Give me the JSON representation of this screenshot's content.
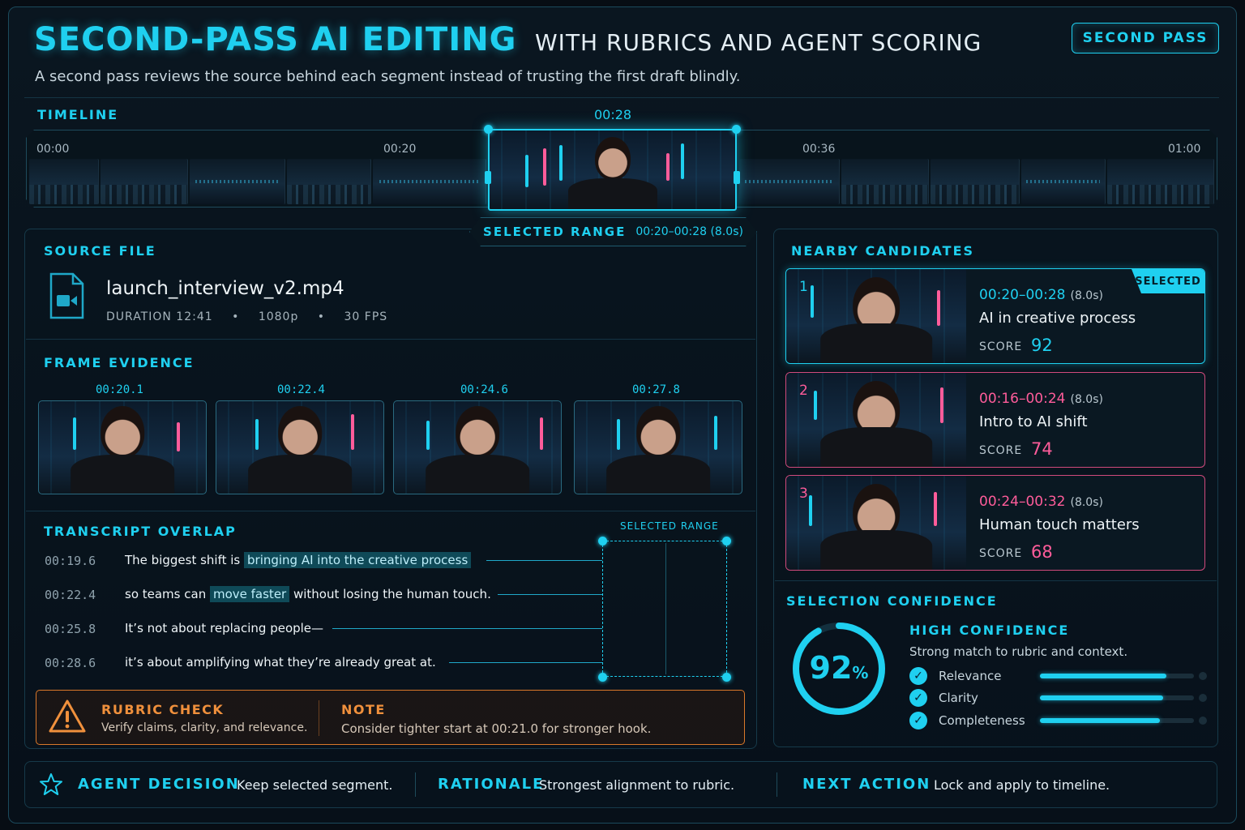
{
  "header": {
    "title": "SECOND-PASS AI EDITING",
    "title_sub": "WITH RUBRICS AND AGENT SCORING",
    "badge": "SECOND PASS",
    "subtitle": "A second pass reviews the source behind each segment instead of trusting the first draft blindly."
  },
  "timeline": {
    "label": "TIMELINE",
    "current": "00:28",
    "ticks": [
      "00:00",
      "00:20",
      "00:36",
      "01:00"
    ]
  },
  "selected_range": {
    "label": "SELECTED RANGE",
    "value": "00:20–00:28 (8.0s)"
  },
  "source_file": {
    "label": "SOURCE FILE",
    "name": "launch_interview_v2.mp4",
    "duration": "DURATION 12:41",
    "resolution": "1080p",
    "fps": "30 FPS",
    "bullet": "•"
  },
  "frame_evidence": {
    "label": "FRAME EVIDENCE",
    "times": [
      "00:20.1",
      "00:22.4",
      "00:24.6",
      "00:27.8"
    ]
  },
  "transcript": {
    "label": "TRANSCRIPT OVERLAP",
    "selected_label": "SELECTED RANGE",
    "lines": [
      {
        "time": "00:19.6",
        "pre": "The biggest shift is ",
        "hl": "bringing AI into the creative process",
        "post": ""
      },
      {
        "time": "00:22.4",
        "pre": "so teams can ",
        "hl": "move faster",
        "post": " without losing the human touch."
      },
      {
        "time": "00:25.8",
        "pre": "It’s not about replacing people—",
        "hl": "",
        "post": ""
      },
      {
        "time": "00:28.6",
        "pre": "it’s about amplifying what they’re already great at.",
        "hl": "",
        "post": ""
      }
    ]
  },
  "rubric": {
    "label": "RUBRIC CHECK",
    "text": "Verify claims, clarity, and relevance.",
    "note_label": "NOTE",
    "note": "Consider tighter start at 00:21.0 for stronger hook."
  },
  "candidates": {
    "label": "NEARBY CANDIDATES",
    "selected_tag": "SELECTED",
    "score_label": "SCORE",
    "items": [
      {
        "num": "1",
        "range": "00:20–00:28",
        "dur": "(8.0s)",
        "caption": "AI in creative process",
        "score": "92"
      },
      {
        "num": "2",
        "range": "00:16–00:24",
        "dur": "(8.0s)",
        "caption": "Intro to AI shift",
        "score": "74"
      },
      {
        "num": "3",
        "range": "00:24–00:32",
        "dur": "(8.0s)",
        "caption": "Human touch matters",
        "score": "68"
      }
    ]
  },
  "confidence": {
    "label": "SELECTION CONFIDENCE",
    "value": "92",
    "unit": "%",
    "fraction": 0.92,
    "level": "HIGH CONFIDENCE",
    "desc": "Strong match to rubric and context.",
    "metrics": [
      {
        "name": "Relevance",
        "fraction": 0.82
      },
      {
        "name": "Clarity",
        "fraction": 0.8
      },
      {
        "name": "Completeness",
        "fraction": 0.78
      }
    ]
  },
  "bottom": {
    "decision_label": "AGENT DECISION",
    "decision": "Keep selected segment.",
    "rationale_label": "RATIONALE",
    "rationale": "Strongest alignment to rubric.",
    "next_label": "NEXT ACTION",
    "next": "Lock and apply to timeline."
  },
  "colors": {
    "accent": "#1fd0f0",
    "alt": "#ff5c9a",
    "warn": "#f0903c",
    "bg": "#070d14"
  },
  "icons": [
    "video-file-icon",
    "warning-icon",
    "star-icon",
    "check-icon"
  ]
}
